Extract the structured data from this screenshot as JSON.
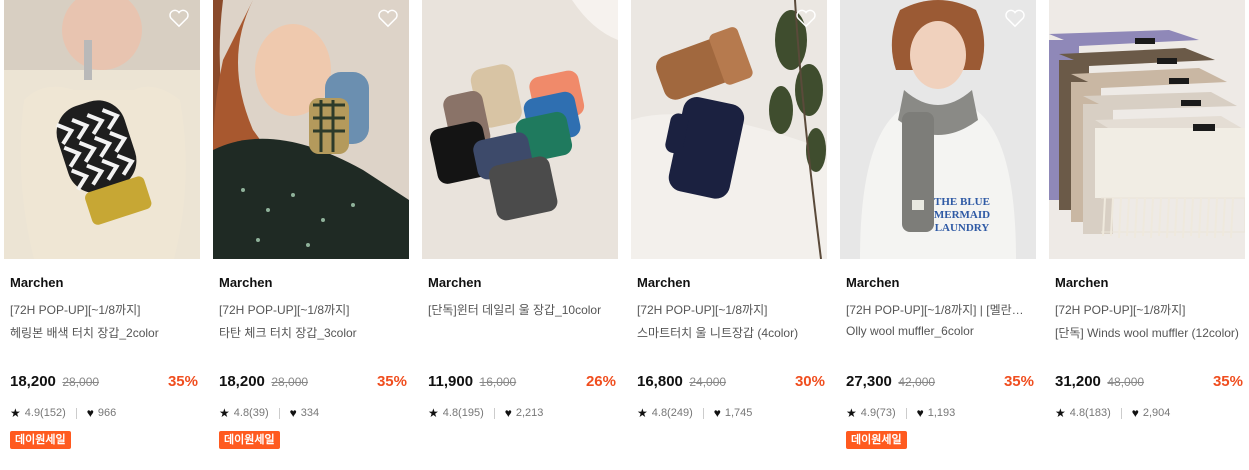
{
  "products": [
    {
      "brand": "Marchen",
      "subtitle": "[72H POP-UP][~1/8까지]",
      "name": "헤링본 배색 터치 장갑_2color",
      "price": "18,200",
      "original_price": "28,000",
      "discount": "35%",
      "rating": "4.9(152)",
      "likes": "966",
      "badge": "데이원세일",
      "image_icon": "herringbone-glove-photo"
    },
    {
      "brand": "Marchen",
      "subtitle": "[72H POP-UP][~1/8까지]",
      "name": "타탄 체크 터치 장갑_3color",
      "price": "18,200",
      "original_price": "28,000",
      "discount": "35%",
      "rating": "4.8(39)",
      "likes": "334",
      "badge": "데이원세일",
      "image_icon": "tartan-glove-photo"
    },
    {
      "brand": "Marchen",
      "subtitle": "[단독]윈터 데일리 울 장갑_10color",
      "name": "",
      "price": "11,900",
      "original_price": "16,000",
      "discount": "26%",
      "rating": "4.8(195)",
      "likes": "2,213",
      "badge": "",
      "image_icon": "colorful-gloves-photo"
    },
    {
      "brand": "Marchen",
      "subtitle": "[72H POP-UP][~1/8까지]",
      "name": "스마트터치 울 니트장갑 (4color)",
      "price": "16,800",
      "original_price": "24,000",
      "discount": "30%",
      "rating": "4.8(249)",
      "likes": "1,745",
      "badge": "",
      "image_icon": "knit-gloves-photo"
    },
    {
      "brand": "Marchen",
      "subtitle": "[72H POP-UP][~1/8까지] | [멜란지 ...",
      "name": "Olly wool muffler_6color",
      "price": "27,300",
      "original_price": "42,000",
      "discount": "35%",
      "rating": "4.9(73)",
      "likes": "1,193",
      "badge": "데이원세일",
      "image_icon": "wool-muffler-photo"
    },
    {
      "brand": "Marchen",
      "subtitle": "[72H POP-UP][~1/8까지]",
      "name": "[단독] Winds wool muffler (12color)",
      "price": "31,200",
      "original_price": "48,000",
      "discount": "35%",
      "rating": "4.8(183)",
      "likes": "2,904",
      "badge": "",
      "image_icon": "stacked-mufflers-photo"
    }
  ],
  "colors": {
    "discount": "#f04e1f",
    "badge_bg": "#ff5a1f"
  }
}
